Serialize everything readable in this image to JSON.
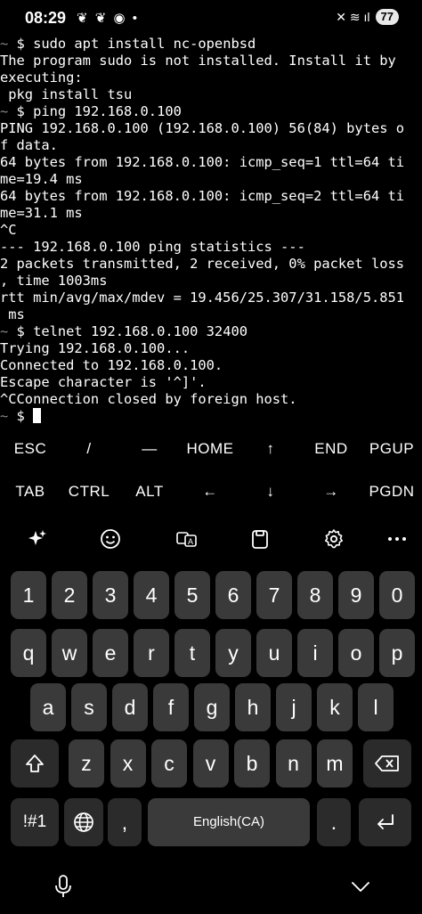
{
  "status_bar": {
    "time": "08:29",
    "left_icons": "❦ ❦ ◉ •",
    "right_icons": "✕ ≋ ıl",
    "battery": "77"
  },
  "terminal": {
    "lines": [
      [
        {
          "t": "~ ",
          "c": "tilde"
        },
        {
          "t": "$ sudo apt install nc-openbsd"
        }
      ],
      [
        {
          "t": "The program sudo is not installed. Install it by"
        }
      ],
      [
        {
          "t": "executing:"
        }
      ],
      [
        {
          "t": " pkg install tsu"
        }
      ],
      [
        {
          "t": "~ ",
          "c": "tilde"
        },
        {
          "t": "$ ping 192.168.0.100"
        }
      ],
      [
        {
          "t": "PING 192.168.0.100 (192.168.0.100) 56(84) bytes o"
        }
      ],
      [
        {
          "t": "f data."
        }
      ],
      [
        {
          "t": "64 bytes from 192.168.0.100: icmp_seq=1 ttl=64 ti"
        }
      ],
      [
        {
          "t": "me=19.4 ms"
        }
      ],
      [
        {
          "t": "64 bytes from 192.168.0.100: icmp_seq=2 ttl=64 ti"
        }
      ],
      [
        {
          "t": "me=31.1 ms"
        }
      ],
      [
        {
          "t": "^C"
        }
      ],
      [
        {
          "t": "--- 192.168.0.100 ping statistics ---"
        }
      ],
      [
        {
          "t": "2 packets transmitted, 2 received, 0% packet loss"
        }
      ],
      [
        {
          "t": ", time 1003ms"
        }
      ],
      [
        {
          "t": "rtt min/avg/max/mdev = 19.456/25.307/31.158/5.851"
        }
      ],
      [
        {
          "t": " ms"
        }
      ],
      [
        {
          "t": "~ ",
          "c": "tilde"
        },
        {
          "t": "$ telnet 192.168.0.100 32400"
        }
      ],
      [
        {
          "t": "Trying 192.168.0.100..."
        }
      ],
      [
        {
          "t": "Connected to 192.168.0.100."
        }
      ],
      [
        {
          "t": "Escape character is '^]'."
        }
      ],
      [
        {
          "t": "^CConnection closed by foreign host."
        }
      ],
      [
        {
          "t": "~ ",
          "c": "tilde"
        },
        {
          "t": "$ "
        },
        {
          "t": "",
          "c": "cursor"
        }
      ]
    ]
  },
  "extra_keys": {
    "row1": [
      {
        "name": "esc-key",
        "label": "ESC"
      },
      {
        "name": "slash-key",
        "label": "/"
      },
      {
        "name": "dash-key",
        "label": "—"
      },
      {
        "name": "home-key",
        "label": "HOME"
      },
      {
        "name": "up-arrow-key",
        "label": "↑"
      },
      {
        "name": "end-key",
        "label": "END"
      },
      {
        "name": "pgup-key",
        "label": "PGUP"
      }
    ],
    "row2": [
      {
        "name": "tab-key",
        "label": "TAB"
      },
      {
        "name": "ctrl-key",
        "label": "CTRL"
      },
      {
        "name": "alt-key",
        "label": "ALT"
      },
      {
        "name": "left-arrow-key",
        "label": "←"
      },
      {
        "name": "down-arrow-key",
        "label": "↓"
      },
      {
        "name": "right-arrow-key",
        "label": "→"
      },
      {
        "name": "pgdn-key",
        "label": "PGDN"
      }
    ]
  },
  "toolbar": {
    "icons": [
      "sparkle-ai-icon",
      "emoji-icon",
      "translate-icon",
      "clipboard-icon",
      "settings-gear-icon",
      "more-dots-icon"
    ]
  },
  "keyboard": {
    "numbers": [
      "1",
      "2",
      "3",
      "4",
      "5",
      "6",
      "7",
      "8",
      "9",
      "0"
    ],
    "row1": [
      "q",
      "w",
      "e",
      "r",
      "t",
      "y",
      "u",
      "i",
      "o",
      "p"
    ],
    "row2": [
      "a",
      "s",
      "d",
      "f",
      "g",
      "h",
      "j",
      "k",
      "l"
    ],
    "row3": [
      "z",
      "x",
      "c",
      "v",
      "b",
      "n",
      "m"
    ],
    "symbols_label": "!#1",
    "comma_label": ",",
    "space_label": "English(CA)",
    "period_label": "."
  },
  "nav_bar": {
    "icons": [
      "microphone-icon",
      "chevron-down-icon"
    ]
  }
}
